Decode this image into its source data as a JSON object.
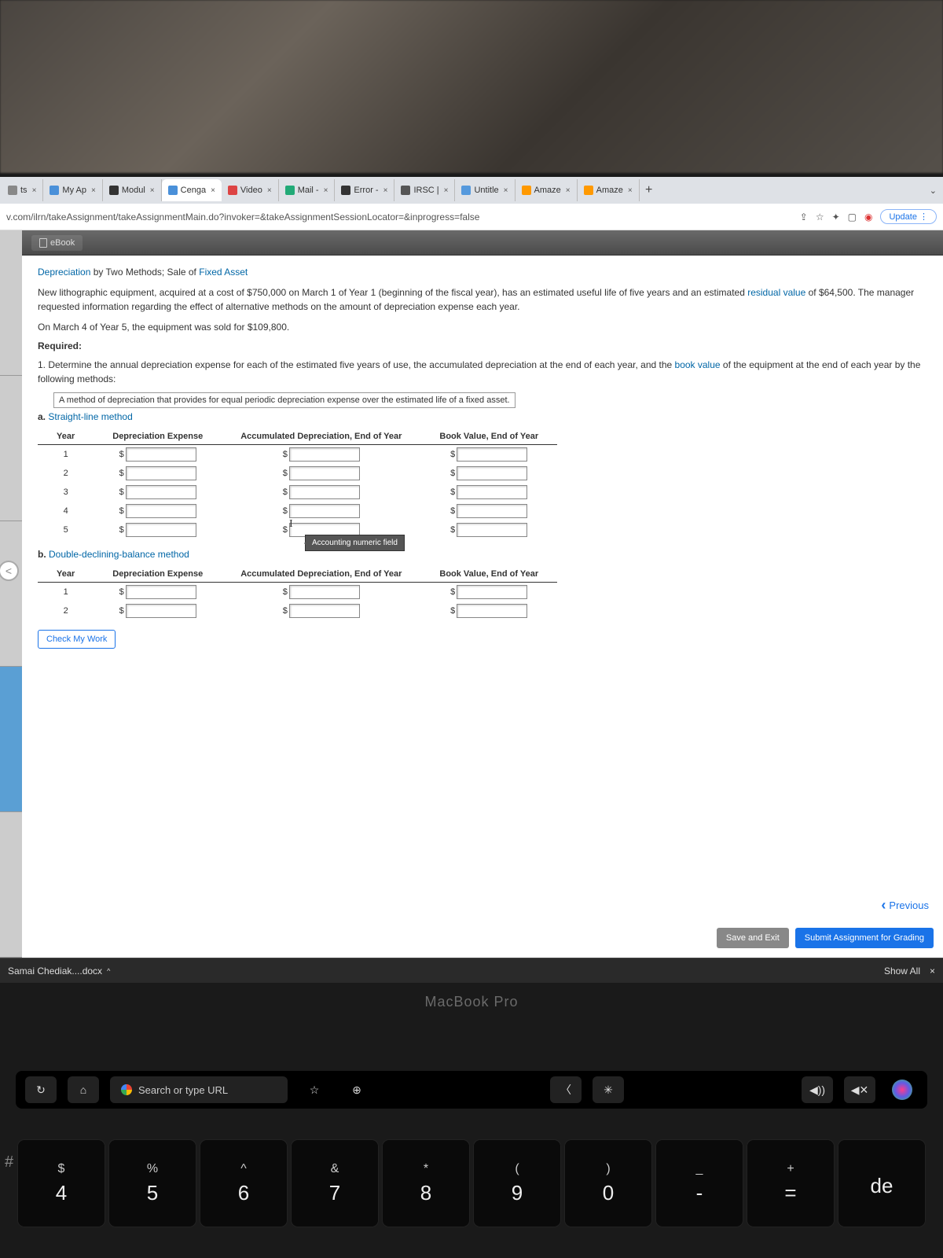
{
  "tabs": [
    {
      "label": "ts",
      "active": false,
      "icon": "#888"
    },
    {
      "label": "My Ap",
      "active": false,
      "icon": "#4a90d9"
    },
    {
      "label": "Modul",
      "active": false,
      "icon": "#333"
    },
    {
      "label": "Cenga",
      "active": true,
      "icon": "#4a90d9"
    },
    {
      "label": "Video",
      "active": false,
      "icon": "#d44"
    },
    {
      "label": "Mail -",
      "active": false,
      "icon": "#2a7"
    },
    {
      "label": "Error -",
      "active": false,
      "icon": "#333"
    },
    {
      "label": "IRSC |",
      "active": false,
      "icon": "#555"
    },
    {
      "label": "Untitle",
      "active": false,
      "icon": "#59d"
    },
    {
      "label": "Amaze",
      "active": false,
      "icon": "#f90"
    },
    {
      "label": "Amaze",
      "active": false,
      "icon": "#f90"
    }
  ],
  "new_tab": "+",
  "url": "v.com/ilrn/takeAssignment/takeAssignmentMain.do?invoker=&takeAssignmentSessionLocator=&inprogress=false",
  "url_actions": {
    "share": "⇪",
    "star": "☆",
    "ext": "✦",
    "window": "▢",
    "rec": "◉",
    "update": "Update  ⋮"
  },
  "ebook": "eBook",
  "problem": {
    "title_a": "Depreciation",
    "title_b": " by Two Methods; Sale of ",
    "title_c": "Fixed Asset",
    "p1a": "New lithographic equipment, acquired at a cost of $750,000 on March 1 of Year 1 (beginning of the fiscal year), has an estimated useful life of five years and an estimated ",
    "p1b": "residual value",
    "p1c": " of $64,500. The manager requested information regarding the effect of alternative methods on the amount of depreciation expense each year.",
    "p2": "On March 4 of Year 5, the equipment was sold for $109,800.",
    "required": "Required:",
    "r1a": "1.  Determine the annual depreciation expense for each of the estimated five years of use, the accumulated depreciation at the end of each year, and the ",
    "r1b": "book value",
    "r1c": " of the equipment at the end of each year by the following methods:",
    "tooltip_def": "A method of depreciation that provides for equal periodic depreciation expense over the estimated life of a fixed asset.",
    "method_a_label": "a.",
    "method_a_link": "Straight-line method",
    "method_b_label": "b.",
    "method_b_link": "Double-declining-balance method"
  },
  "table_headers": {
    "year": "Year",
    "dep": "Depreciation Expense",
    "acc": "Accumulated Depreciation, End of Year",
    "bv": "Book Value, End of Year"
  },
  "table_a_years": [
    "1",
    "2",
    "3",
    "4",
    "5"
  ],
  "table_b_years": [
    "1",
    "2"
  ],
  "dollar": "$",
  "field_tip": "Accounting numeric field",
  "check_btn": "Check My Work",
  "previous": "Previous",
  "save_exit": "Save and Exit",
  "submit": "Submit Assignment for Grading",
  "download": {
    "file": "Samai Chediak....docx",
    "caret": "^",
    "show_all": "Show All",
    "close": "×"
  },
  "macbook": "MacBook Pro",
  "touchbar": {
    "refresh": "↻",
    "home": "⌂",
    "search": "Search or type URL",
    "star": "☆",
    "plus": "⊕",
    "back": "〈",
    "bright": "✳",
    "vol": "◀))",
    "mute": "◀✕"
  },
  "keys": [
    {
      "up": "$",
      "dn": "4"
    },
    {
      "up": "%",
      "dn": "5"
    },
    {
      "up": "^",
      "dn": "6"
    },
    {
      "up": "&",
      "dn": "7"
    },
    {
      "up": "*",
      "dn": "8"
    },
    {
      "up": "(",
      "dn": "9"
    },
    {
      "up": ")",
      "dn": "0"
    },
    {
      "up": "_",
      "dn": "-"
    },
    {
      "up": "+",
      "dn": "="
    },
    {
      "up": "",
      "dn": "de"
    }
  ],
  "hash": "#"
}
